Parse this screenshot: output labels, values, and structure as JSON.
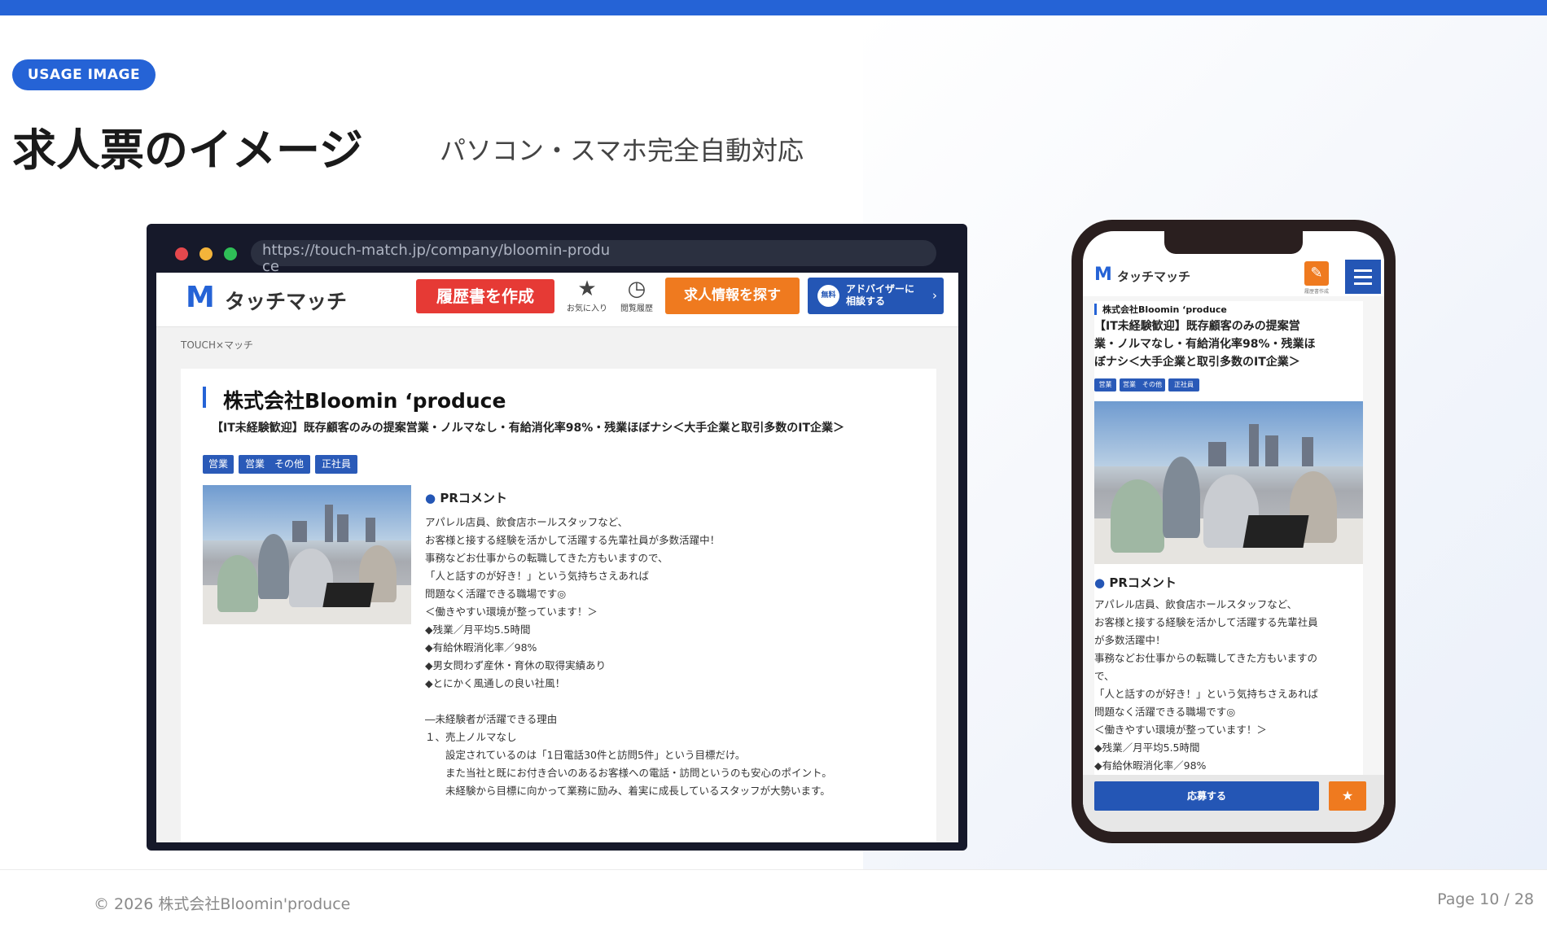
{
  "slide": {
    "badge": "USAGE IMAGE",
    "title": "求人票のイメージ",
    "subtitle": "パソコン・スマホ完全自動対応",
    "copyright": "© 2026 株式会社Bloomin'produce",
    "page": "Page 10 / 28",
    "accent_color": "#2563d6"
  },
  "browser": {
    "url": "https://touch-match.jp/company/bloomin-produce",
    "logo_mark": "M",
    "logo_text": "タッチマッチ",
    "resume_button": "履歴書を作成",
    "favorites_label": "お気に入り",
    "favorites_icon": "star-icon",
    "history_label": "閲覧履歴",
    "history_icon": "clock-icon",
    "search_button": "求人情報を探す",
    "advisor_badge": "無料",
    "advisor_line1": "アドバイザーに",
    "advisor_line2": "相談する",
    "breadcrumb": "TOUCH×マッチ",
    "company": "株式会社Bloomin ‘produce",
    "job_title": "【IT未経験歓迎】既存顧客のみの提案営業・ノルマなし・有給消化率98%・残業ほぼナシ＜大手企業と取引多数のIT企業＞",
    "tags": [
      "営業",
      "営業　その他",
      "正社員"
    ],
    "pr_heading": "PRコメント",
    "pr_lines": [
      "アパレル店員、飲食店ホールスタッフなど、",
      "お客様と接する経験を活かして活躍する先輩社員が多数活躍中！",
      "事務などお仕事からの転職してきた方もいますので、",
      "「人と話すのが好き！」という気持ちさえあれば",
      "問題なく活躍できる職場です◎",
      "＜働きやすい環境が整っています！＞",
      "◆残業／月平均5.5時間",
      "◆有給休暇消化率／98%",
      "◆男女問わず産休・育休の取得実績あり",
      "◆とにかく風通しの良い社風！",
      "",
      "―未経験者が活躍できる理由",
      "１、売上ノルマなし",
      "　　設定されているのは「1日電話30件と訪問5件」という目標だけ。",
      "　　また当社と既にお付き合いのあるお客様への電話・訪問というのも安心のポイント。",
      "　　未経験から目標に向かって業務に励み、着実に成長しているスタッフが大勢います。"
    ]
  },
  "phone": {
    "logo_mark": "M",
    "logo_text": "タッチマッチ",
    "edit_label": "履歴書作成",
    "company": "株式会社Bloomin ‘produce",
    "job_title_lines": [
      "【IT未経験歓迎】既存顧客のみの提案営",
      "業・ノルマなし・有給消化率98%・残業ほ",
      "ぼナシ＜大手企業と取引多数のIT企業＞"
    ],
    "tags": [
      "営業",
      "営業　その他",
      "正社員"
    ],
    "pr_heading": "PRコメント",
    "pr_lines": [
      "アパレル店員、飲食店ホールスタッフなど、",
      "お客様と接する経験を活かして活躍する先輩社員",
      "が多数活躍中！",
      "事務などお仕事からの転職してきた方もいますの",
      "で、",
      "「人と話すのが好き！」という気持ちさえあれば",
      "問題なく活躍できる職場です◎",
      "＜働きやすい環境が整っています！＞",
      "◆残業／月平均5.5時間",
      "◆有給休暇消化率／98%"
    ],
    "apply_button": "応募する",
    "star_icon": "star-icon"
  }
}
